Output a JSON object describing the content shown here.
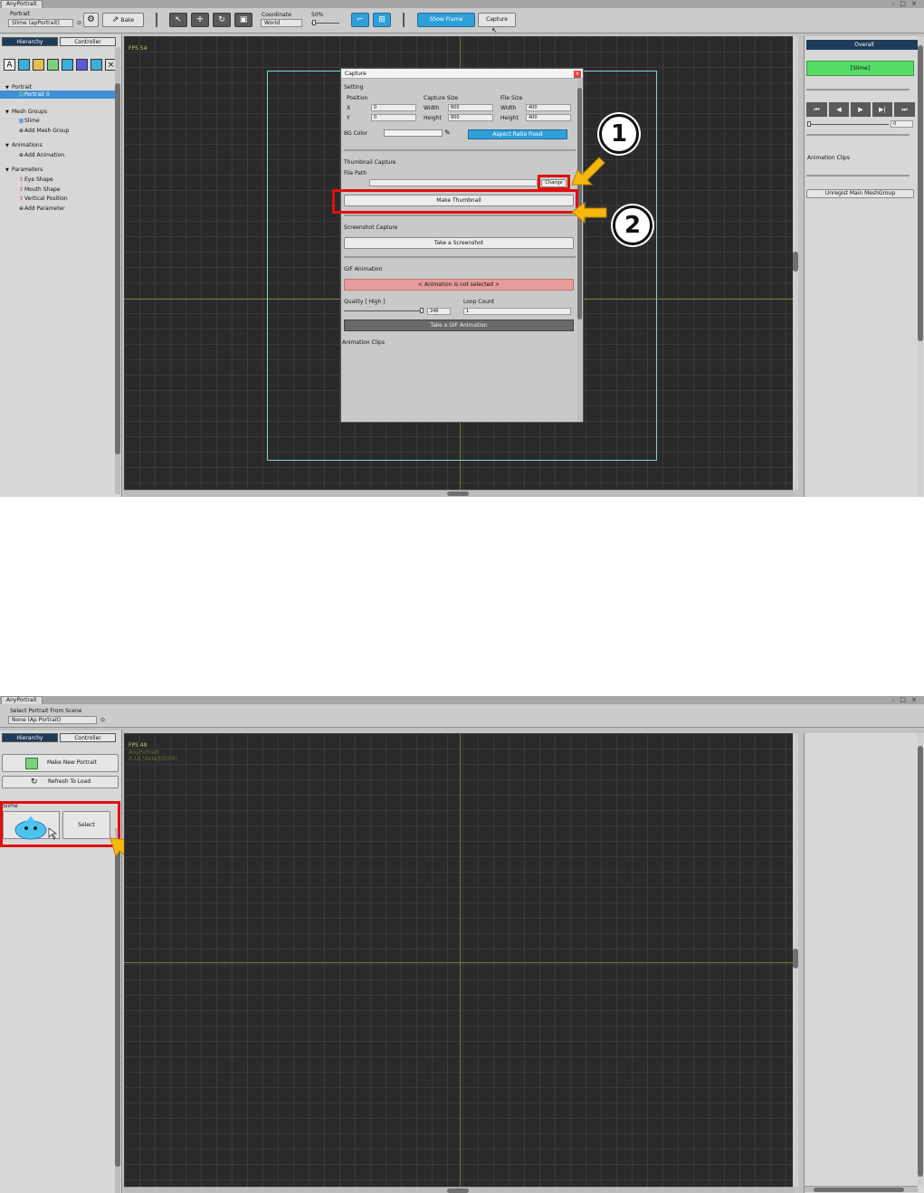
{
  "shot1": {
    "window_tab": "AnyPortrait",
    "window_buttons": ": □ ×",
    "toolbar": {
      "portrait_label": "Portrait",
      "portrait_value": "Slime (apPortrait)",
      "bake_label": "Bake",
      "coordinate_label": "Coordinate",
      "coordinate_value": "World",
      "zoom_value": "50%",
      "show_frame_label": "Show Frame",
      "capture_label": "Capture"
    },
    "tabs": {
      "hierarchy": "Hierarchy",
      "controller": "Controller"
    },
    "tree": {
      "portrait_header": "Portrait",
      "portrait_item": "Portrait 0",
      "mesh_groups_header": "Mesh Groups",
      "mesh_item": "Slime",
      "add_mesh_group": "Add Mesh Group",
      "animations_header": "Animations",
      "add_animation": "Add Animation",
      "parameters_header": "Parameters",
      "params": [
        "Eye Shape",
        "Mouth Shape",
        "Vertical Position"
      ],
      "add_parameter": "Add Parameter"
    },
    "fps": "FPS 54",
    "right": {
      "overall": "Overall",
      "slime_button": "[Slime]",
      "frame_value": "0",
      "animation_clips": "Animation Clips",
      "unregist": "Unregist Main MeshGroup"
    },
    "dialog": {
      "title": "Capture",
      "close": "x",
      "setting": "Setting",
      "position": "Position",
      "capture_size": "Capture Size",
      "file_size": "File Size",
      "x_label": "X",
      "x_value": "0",
      "y_label": "Y",
      "y_value": "0",
      "cap_width_label": "Width",
      "cap_width_value": "800",
      "cap_height_label": "Height",
      "cap_height_value": "800",
      "file_width_label": "Width",
      "file_width_value": "400",
      "file_height_label": "Height",
      "file_height_value": "400",
      "bg_color": "BG Color",
      "aspect": "Aspect Ratio Fixed",
      "thumb_capture": "Thumbnail Capture",
      "file_path": "File Path",
      "change": "Change",
      "make_thumbnail": "Make Thumbnail",
      "screenshot_capture": "Screenshot Capture",
      "take_screenshot": "Take a Screenshot",
      "gif_animation": "GIF Animation",
      "not_selected": "< Animation is not selected >",
      "quality": "Quality [ High ]",
      "quality_value": "246",
      "loop_count": "Loop Count",
      "loop_value": "1",
      "take_gif": "Take a GIF Animation",
      "animation_clips": "Animation Clips"
    },
    "callouts": {
      "one": "1",
      "two": "2"
    }
  },
  "shot2": {
    "window_tab": "AnyPortrait",
    "window_buttons": ": □ ×",
    "select_label": "Select Portrait From Scene",
    "select_value": "None (Ap Portrait)",
    "tabs": {
      "hierarchy": "Hierarchy",
      "controller": "Controller"
    },
    "make_new": "Make New Portrait",
    "refresh": "Refresh To Load",
    "slime_label": "Slime",
    "select_button": "Select",
    "fps": "FPS 49",
    "overlay_line1": "AnyPortrait",
    "overlay_line2": "0.18 [Beta][0104]"
  },
  "colors": {
    "accent_blue": "#2f9fd8",
    "highlight_red": "#e01010",
    "arrow_yellow": "#f6b80f",
    "green_button": "#55dd66",
    "warning_pink": "#e79b9b",
    "canvas": "#2a2a2a",
    "dark_header": "#1e3c5a"
  }
}
